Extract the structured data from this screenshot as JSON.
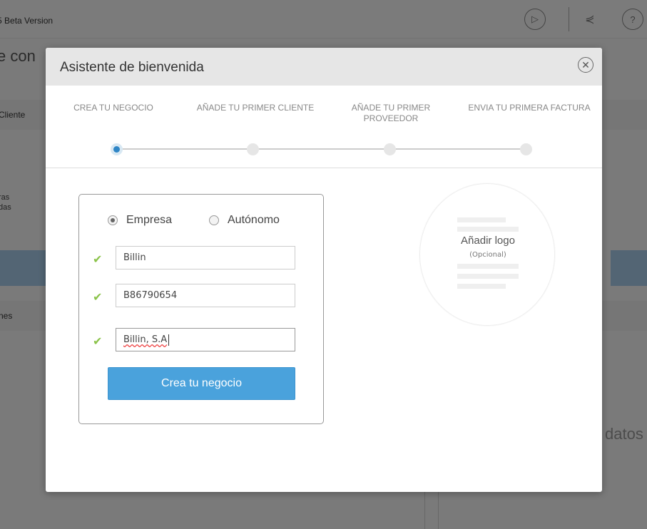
{
  "background": {
    "brand": "Beta Version",
    "page_title": "e con",
    "clients_label": "Cliente",
    "small_text_1": "ras",
    "small_text_2": "das",
    "section_label": "nes",
    "empty_text": "datos"
  },
  "modal": {
    "title": "Asistente de bienvenida",
    "steps": [
      {
        "label": "CREA TU NEGOCIO",
        "active": true
      },
      {
        "label": "AÑADE TU PRIMER CLIENTE",
        "active": false
      },
      {
        "label": "AÑADE TU PRIMER PROVEEDOR",
        "active": false
      },
      {
        "label": "ENVIA TU PRIMERA FACTURA",
        "active": false
      }
    ],
    "form": {
      "type_options": [
        {
          "label": "Empresa",
          "selected": true
        },
        {
          "label": "Autónomo",
          "selected": false
        }
      ],
      "name_value": "Billin",
      "tax_id_value": "B86790654",
      "legal_name_value": "Billin, S.A",
      "submit_label": "Crea tu negocio"
    },
    "logo": {
      "label": "Añadir logo",
      "sublabel": "(Opcional)"
    }
  },
  "colors": {
    "accent": "#4aa2dc",
    "active_step": "#2f86c6",
    "valid_check": "#8bc34a"
  }
}
